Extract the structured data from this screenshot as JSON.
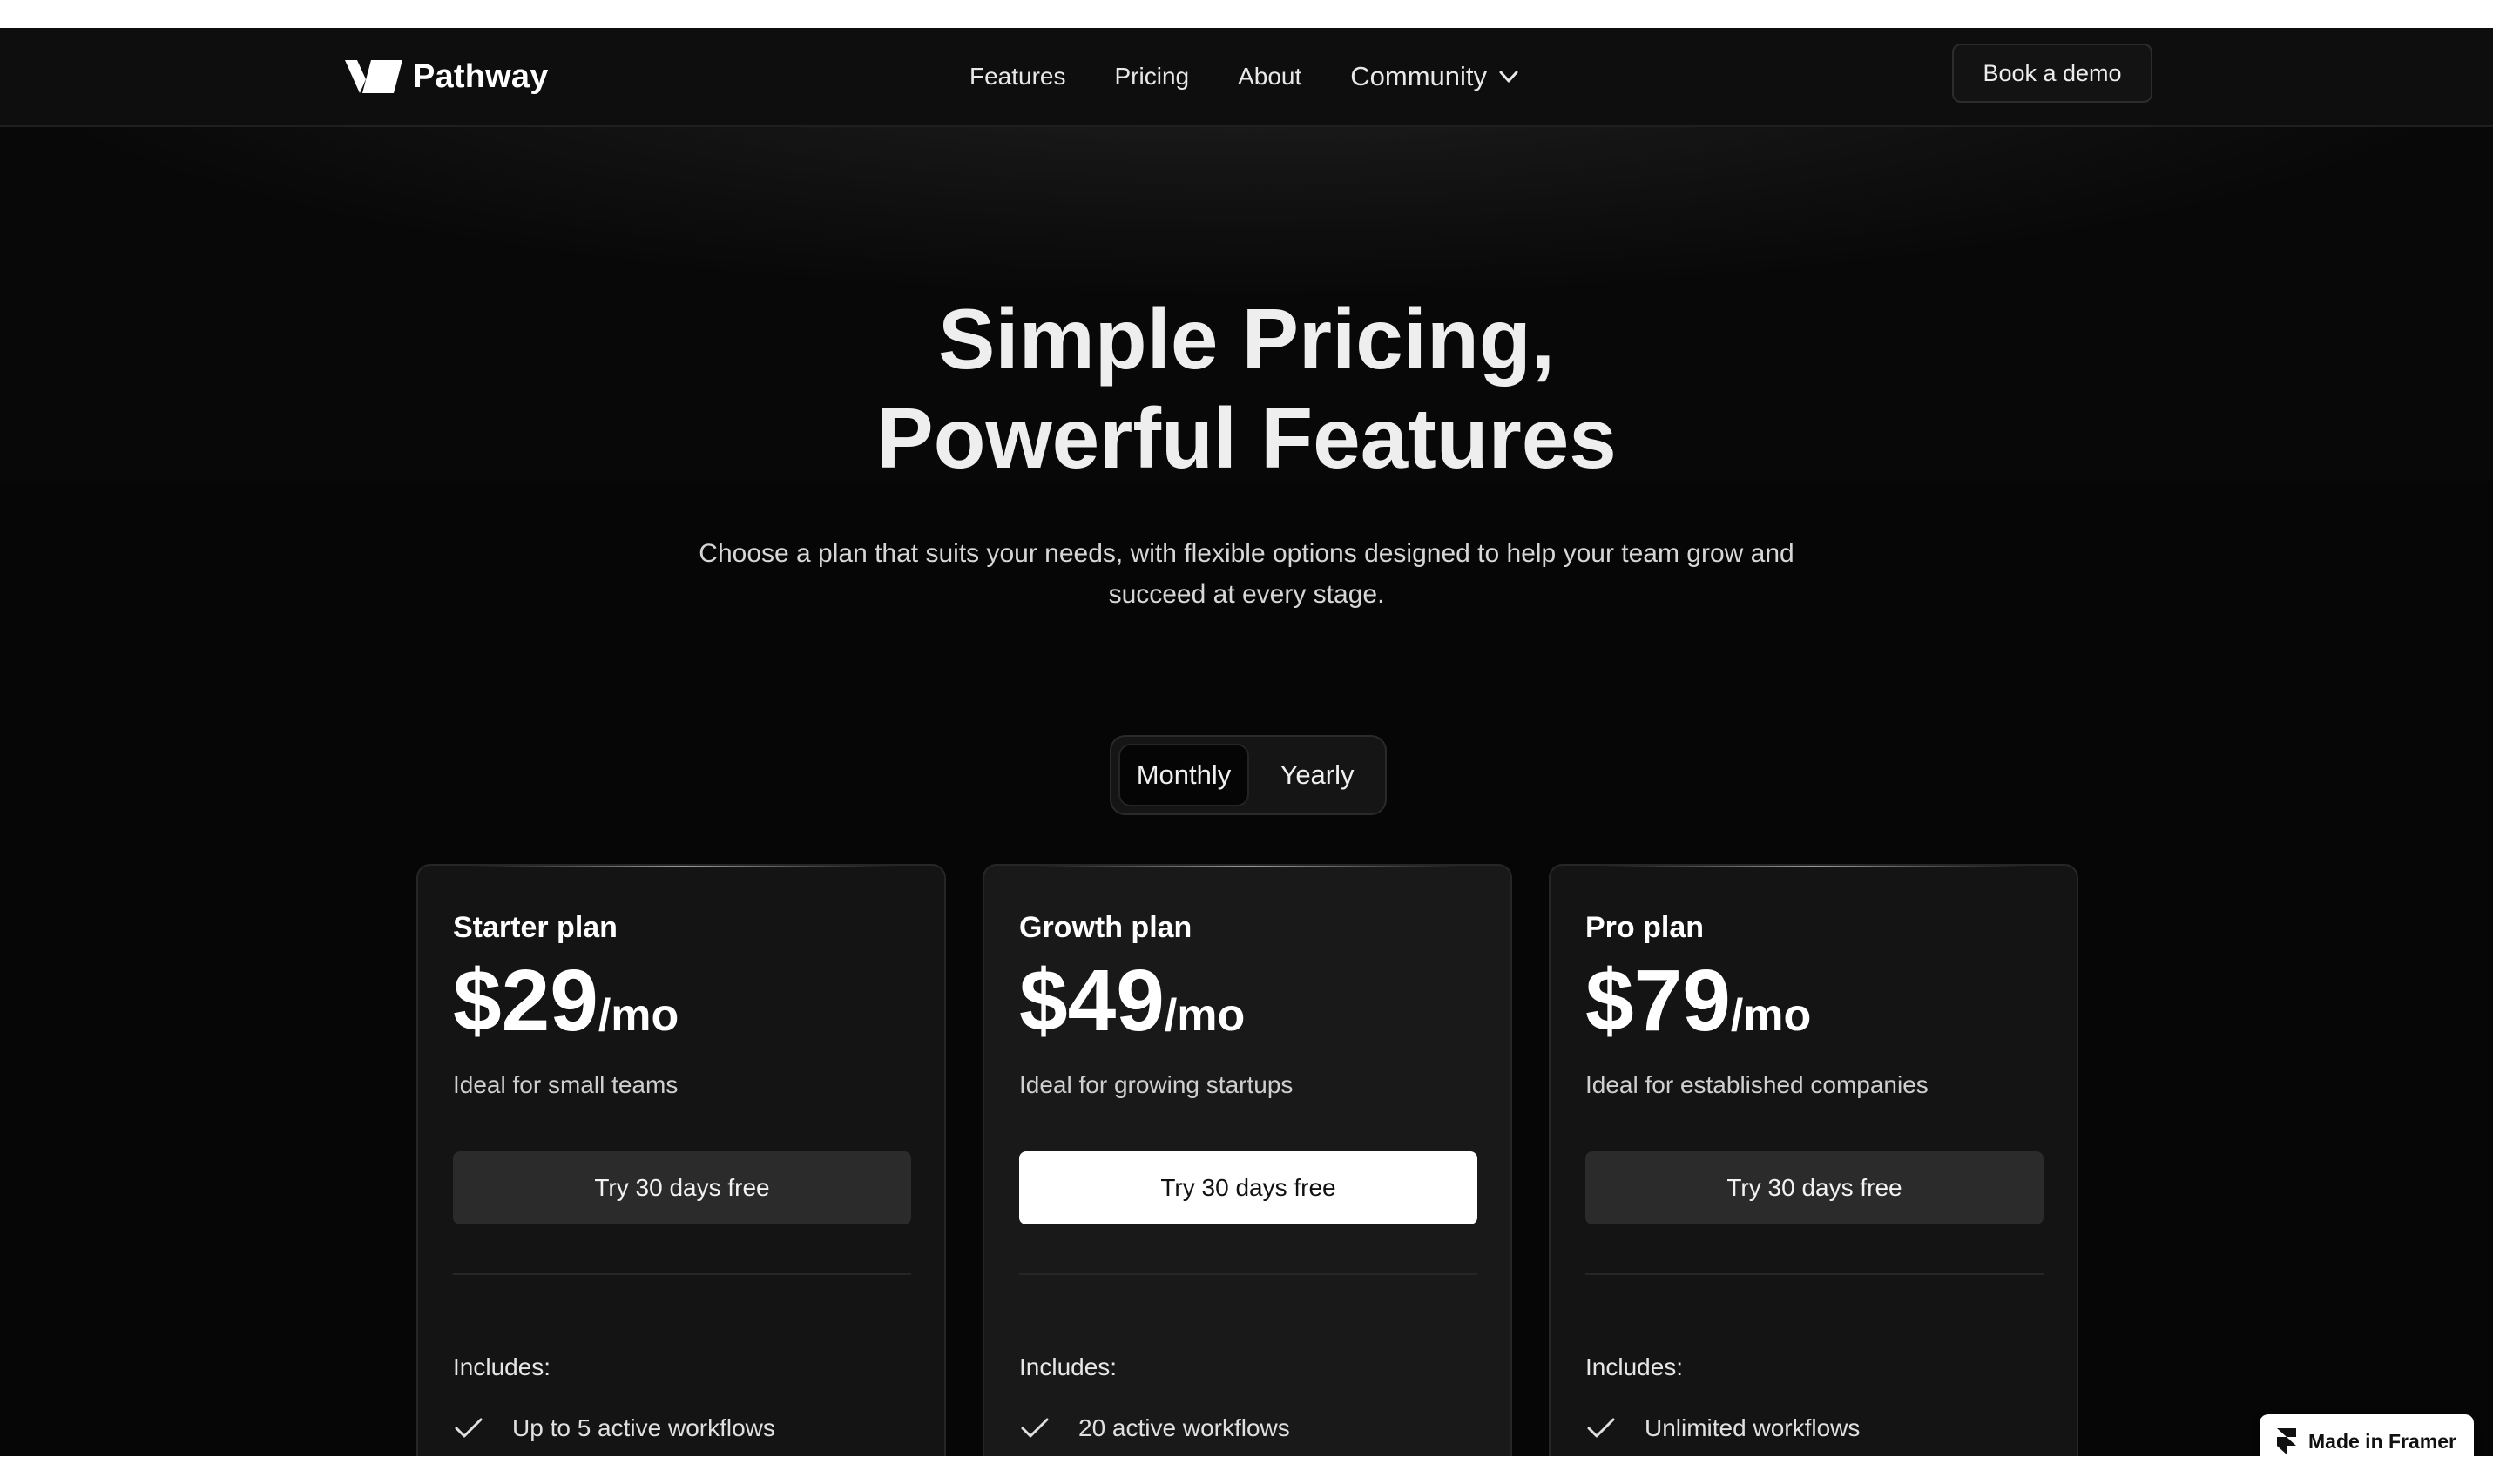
{
  "nav": {
    "brand": "Pathway",
    "links": [
      "Features",
      "Pricing",
      "About"
    ],
    "community": "Community",
    "demo_button": "Book a demo"
  },
  "hero": {
    "title_line1": "Simple Pricing,",
    "title_line2": "Powerful Features",
    "subtitle": "Choose a plan that suits your needs, with flexible options designed to help your team grow and succeed at every stage."
  },
  "billing_toggle": {
    "options": [
      "Monthly",
      "Yearly"
    ],
    "selected": "Monthly"
  },
  "plans": [
    {
      "name": "Starter plan",
      "price": "$29",
      "period": "/mo",
      "description": "Ideal for small teams",
      "cta": "Try 30 days free",
      "includes_label": "Includes:",
      "features": [
        "Up to 5 active workflows"
      ]
    },
    {
      "name": "Growth plan",
      "price": "$49",
      "period": "/mo",
      "description": "Ideal for growing startups",
      "cta": "Try 30 days free",
      "includes_label": "Includes:",
      "features": [
        "20 active workflows"
      ]
    },
    {
      "name": "Pro plan",
      "price": "$79",
      "period": "/mo",
      "description": "Ideal for established companies",
      "cta": "Try 30 days free",
      "includes_label": "Includes:",
      "features": [
        "Unlimited workflows"
      ]
    }
  ],
  "badge": {
    "label": "Made in Framer"
  },
  "icons": {
    "logo": "pathway-logo-icon",
    "dropdown": "chevron-down-icon",
    "feature": "check-icon",
    "framer": "framer-icon"
  },
  "colors": {
    "background": "#060606",
    "nav_background": "#0e0e0e",
    "card": "#141414",
    "button_dark": "#2b2b2b",
    "button_primary": "#ffffff",
    "text": "#ffffff"
  }
}
